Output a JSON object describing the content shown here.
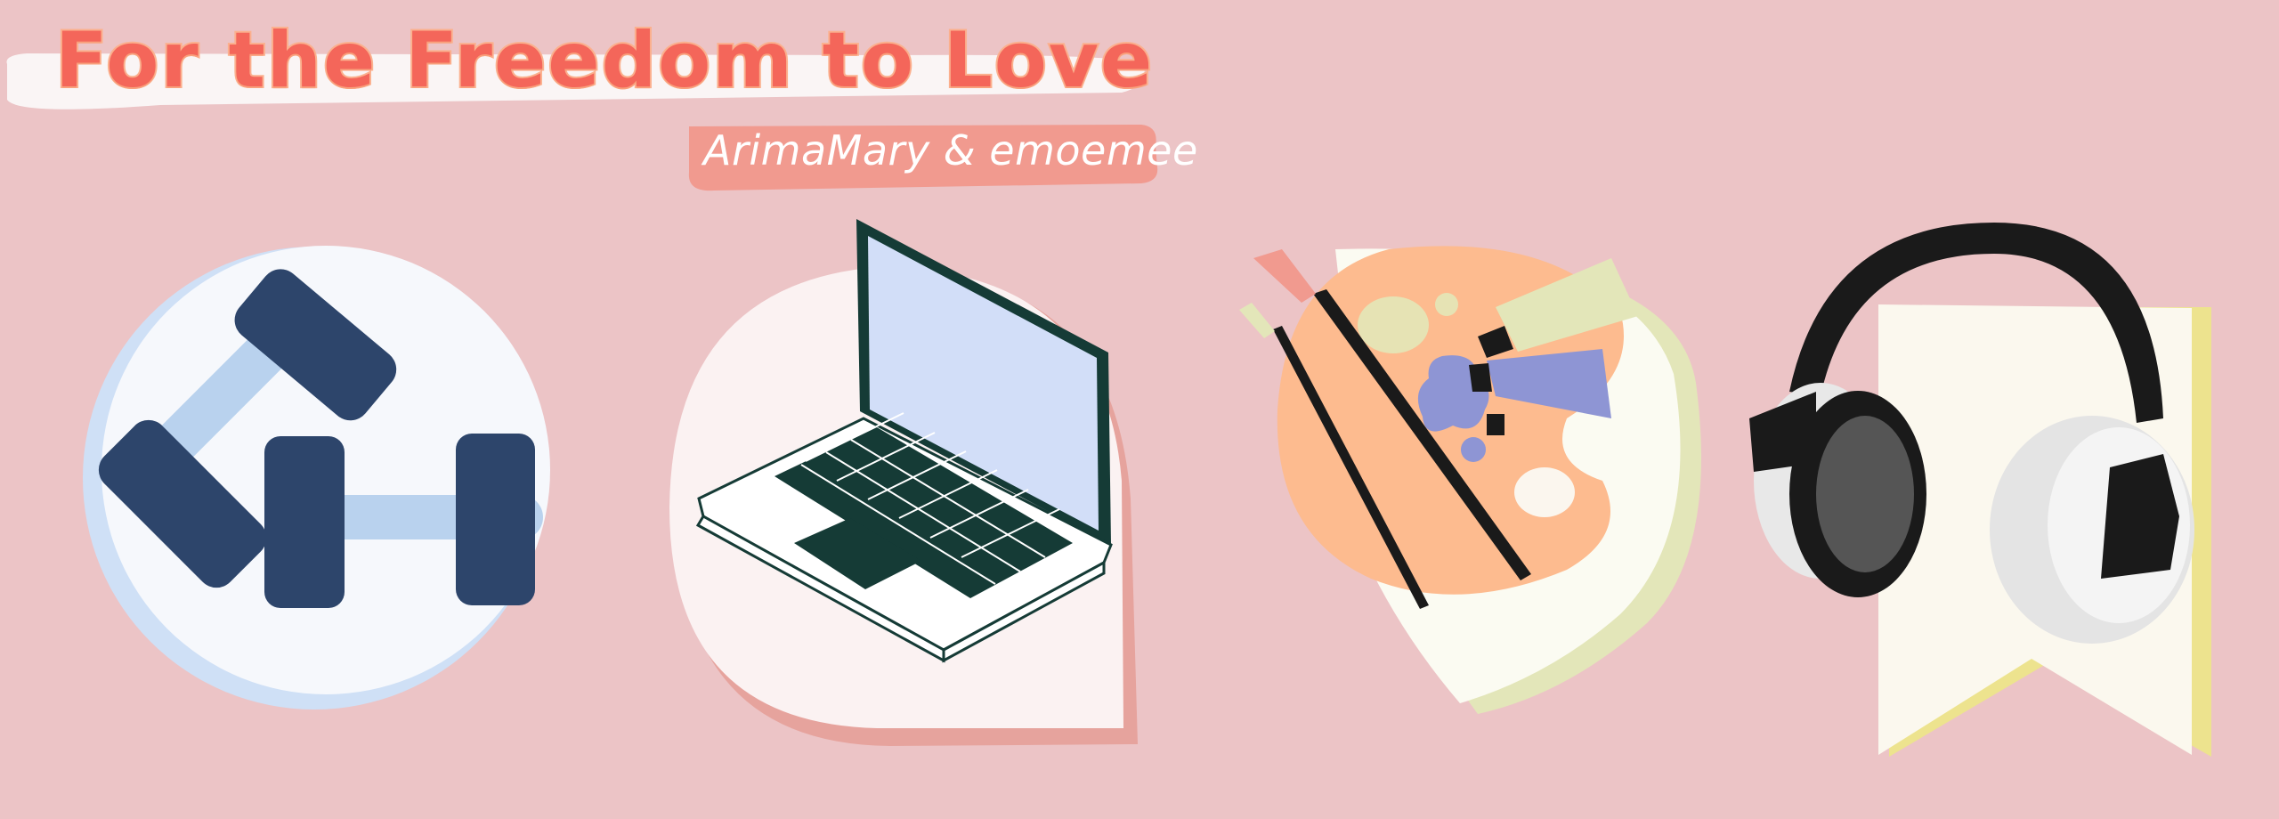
{
  "header": {
    "title": "For the Freedom to Love",
    "authors": "ArimaMary & emoemee"
  },
  "illustrations": [
    {
      "icon": "dumbbells-icon"
    },
    {
      "icon": "laptop-icon"
    },
    {
      "icon": "paint-palette-icon"
    },
    {
      "icon": "headphones-icon"
    }
  ],
  "colors": {
    "background": "#ecc4c6",
    "title_fill": "#f4665a",
    "title_outline": "#fbb08e",
    "subtitle_banner": "#f19a8f",
    "navy": "#2d456b",
    "light_blue": "#b9d2ee",
    "laptop_dark": "#153b36",
    "palette_orange": "#fdbb8f",
    "paint_purple": "#8e95d4",
    "headphone_black": "#1a1a1a",
    "bookmark_cream": "#fbf8ee",
    "bookmark_yellow": "#ede38e"
  }
}
